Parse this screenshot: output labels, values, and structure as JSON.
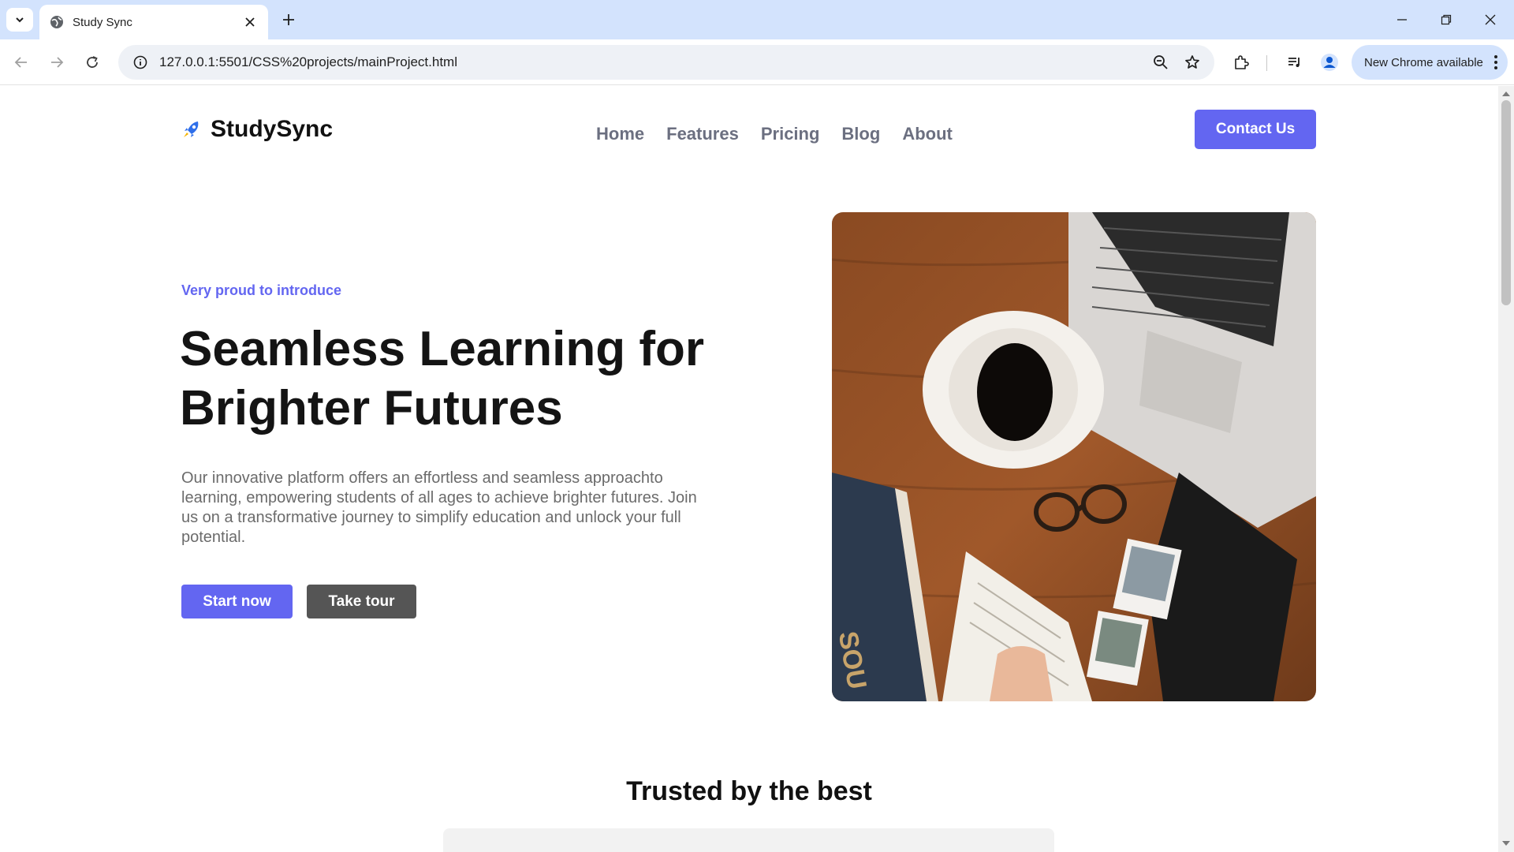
{
  "browser": {
    "tab_title": "Study Sync",
    "url": "127.0.0.1:5501/CSS%20projects/mainProject.html",
    "update_button": "New Chrome available",
    "icons": [
      "tab-search-icon",
      "globe-icon",
      "close-icon",
      "plus-icon",
      "minimize-icon",
      "restore-icon",
      "back-icon",
      "forward-icon",
      "reload-icon",
      "site-info-icon",
      "zoom-icon",
      "star-icon",
      "extensions-icon",
      "media-icon",
      "profile-icon",
      "more-icon"
    ]
  },
  "page": {
    "logo_text": "StudySync",
    "nav": [
      "Home",
      "Features",
      "Pricing",
      "Blog",
      "About"
    ],
    "contact_label": "Contact Us",
    "eyebrow": "Very proud to introduce",
    "title_line1": "Seamless Learning for",
    "title_line2": "Brighter Futures",
    "description": "Our innovative platform offers an effortless and seamless approachto learning, empowering students of all ages to achieve brighter futures. Join us on a transformative journey to simplify education and unlock your full potential.",
    "start_label": "Start now",
    "tour_label": "Take tour",
    "trusted_heading": "Trusted by the best"
  },
  "colors": {
    "accent": "#6366f1",
    "secondary_button": "#555555",
    "nav_text": "#6b6f80",
    "chrome_tabbar": "#d3e3fd"
  }
}
